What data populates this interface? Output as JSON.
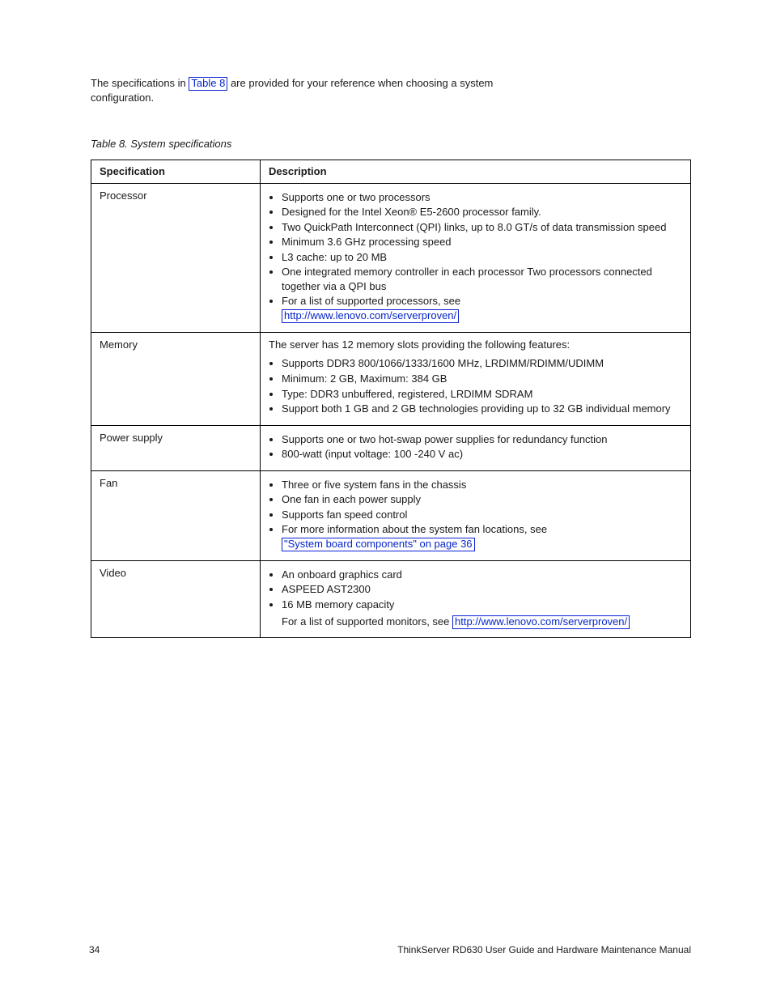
{
  "intro": {
    "line1_pre": "The specifications in ",
    "line1_link": "Table 8",
    "line1_post": " are provided for your reference when choosing a system",
    "line2": "configuration."
  },
  "table": {
    "caption": "Table 8. System specifications",
    "headers": [
      "Specification",
      "Description"
    ],
    "rows": [
      {
        "category": "Processor",
        "intro": "",
        "items": [
          "Supports one or two processors",
          "Designed for the Intel Xeon® E5-2600 processor family.",
          "Two QuickPath Interconnect (QPI) links, up to 8.0 GT/s of data transmission speed",
          "Minimum 3.6 GHz processing speed",
          "L3 cache: up to 20 MB",
          "One integrated memory controller in each processor Two processors connected together via a QPI bus",
          "For a list of supported processors, see"
        ],
        "link": "http://www.lenovo.com/serverproven/"
      },
      {
        "category": "Memory",
        "intro": "The server has 12 memory slots providing the following features:",
        "items": [
          "Supports DDR3 800/1066/1333/1600 MHz, LRDIMM/RDIMM/UDIMM",
          "Minimum: 2 GB, Maximum: 384 GB",
          "Type: DDR3 unbuffered, registered, LRDIMM SDRAM",
          "Support both 1 GB and 2 GB technologies providing up to 32 GB individual memory"
        ]
      },
      {
        "category": "Power supply",
        "items": [
          "Supports one or two hot-swap power supplies for redundancy function",
          "800-watt (input voltage: 100 -240 V ac)"
        ]
      },
      {
        "category": "Fan",
        "items": [
          "Three or five system fans in the chassis",
          "One fan in each power supply",
          "Supports fan speed control",
          "For more information about the system fan locations, see"
        ],
        "link": "\"System board components\" on page 36"
      },
      {
        "category": "Video",
        "items": [
          "An onboard graphics card",
          "ASPEED AST2300",
          "16 MB memory capacity"
        ],
        "note_pre": "For a list of supported monitors, see ",
        "note_link": "http://www.lenovo.com/serverproven/"
      }
    ]
  },
  "pageno": "34",
  "footer": "ThinkServer RD630 User Guide and Hardware Maintenance Manual"
}
